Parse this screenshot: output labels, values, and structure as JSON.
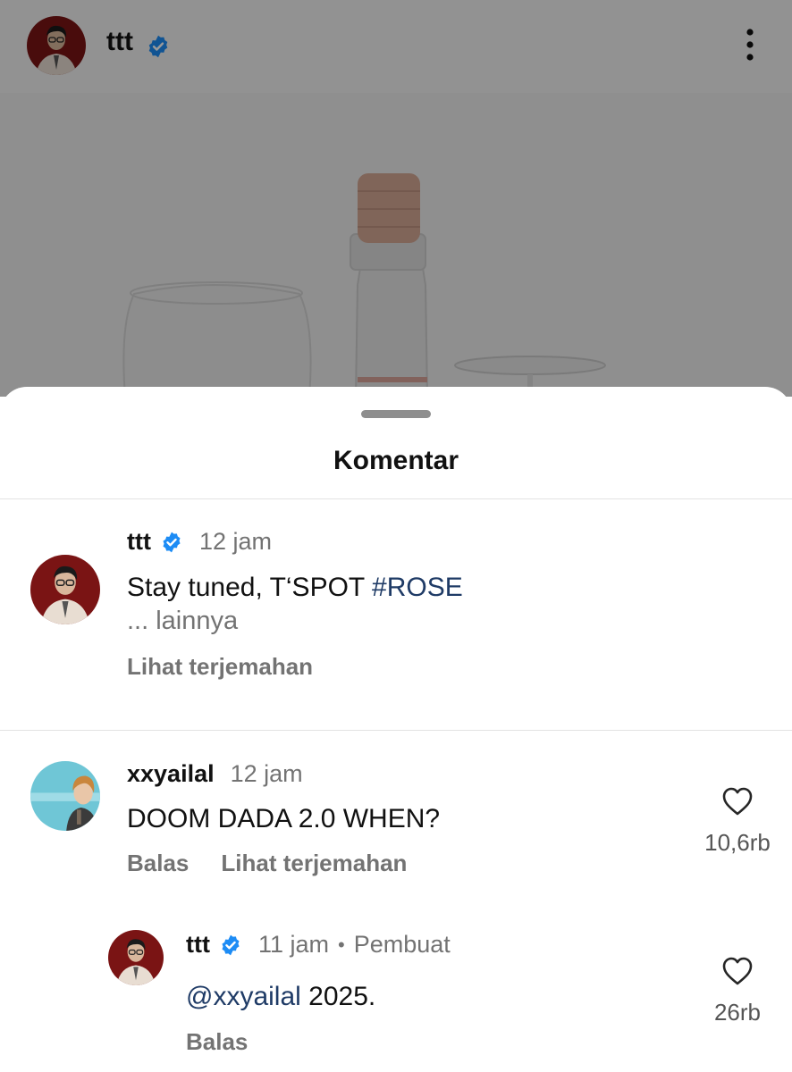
{
  "post": {
    "username": "ttt"
  },
  "sheet": {
    "title": "Komentar"
  },
  "caption": {
    "username": "ttt",
    "time": "12 jam",
    "text_prefix": "Stay tuned, T‘SPOT ",
    "hashtag": "#ROSE",
    "more_label": "... lainnya",
    "translate_label": "Lihat terjemahan"
  },
  "comments": [
    {
      "username": "xxyailal",
      "time": "12 jam",
      "text": "DOOM DADA 2.0 WHEN?",
      "reply_label": "Balas",
      "translate_label": "Lihat terjemahan",
      "like_count": "10,6rb"
    },
    {
      "username": "ttt",
      "time": "11 jam",
      "separator": "•",
      "role": "Pembuat",
      "mention": "@xxyailal",
      "text": " 2025.",
      "reply_label": "Balas",
      "like_count": "26rb"
    }
  ],
  "colors": {
    "verified": "#1d8cf5",
    "link": "#1f3b66",
    "secondary_text": "#737373"
  },
  "icons": [
    "verified-badge-icon",
    "more-options-icon",
    "heart-icon"
  ]
}
